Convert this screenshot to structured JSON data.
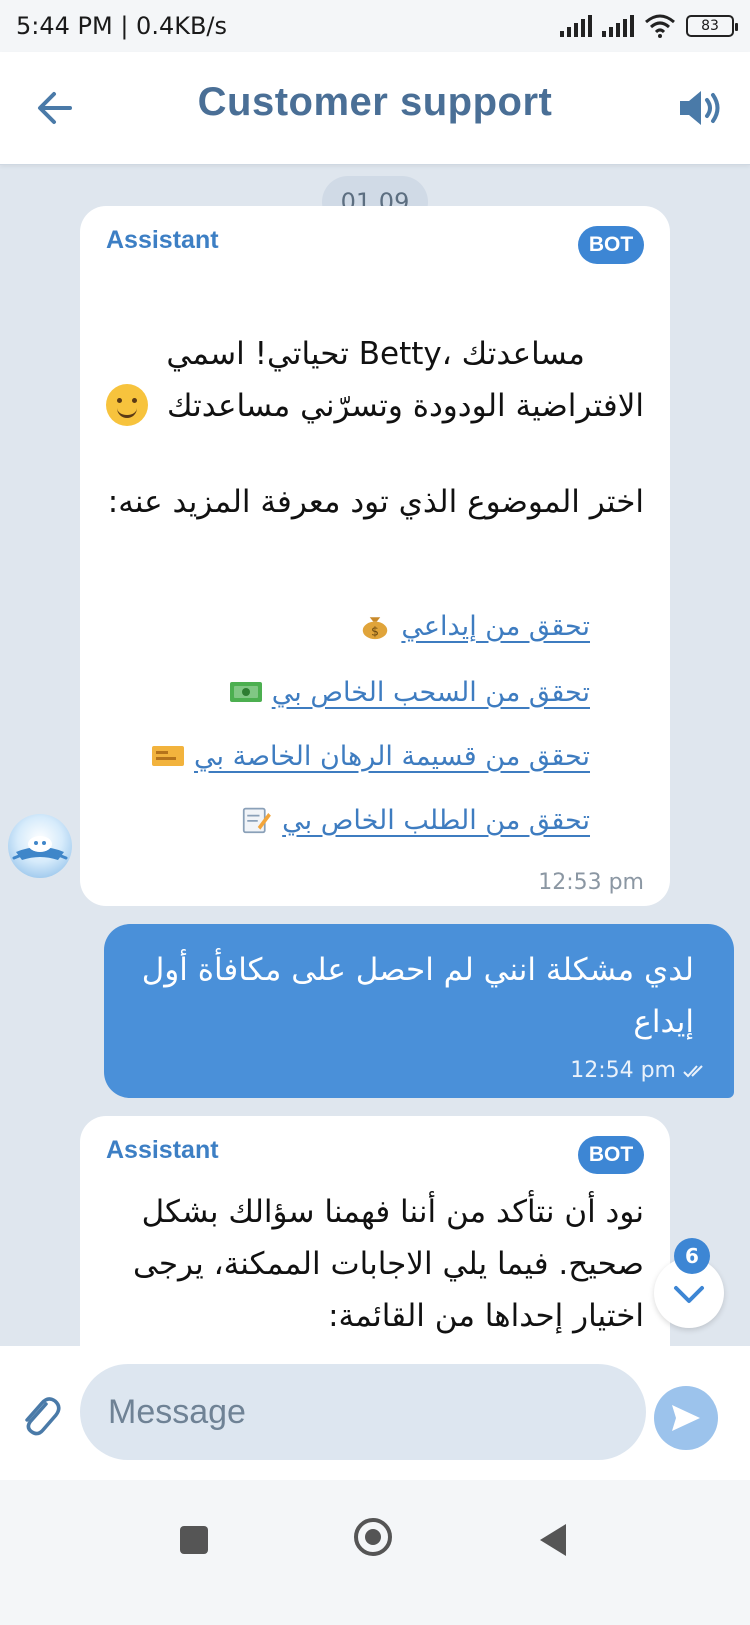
{
  "status_bar": {
    "time": "5:44 PM | 0.4KB/s",
    "battery": "83"
  },
  "header": {
    "title": "Customer support"
  },
  "chat": {
    "date_chip": "01.09",
    "message1": {
      "sender": "Assistant",
      "badge": "BOT",
      "text": "مساعدتك ،Betty تحياتي! اسمي الافتراضية الودودة وتسرّني مساعدتك",
      "prompt": "اختر الموضوع الذي تود معرفة المزيد عنه:",
      "links": [
        {
          "label": "تحقق من إيداعي",
          "icon": "money-bag-icon"
        },
        {
          "label": "تحقق من السحب الخاص بي",
          "icon": "banknote-icon"
        },
        {
          "label": "تحقق من قسيمة الرهان الخاصة بي",
          "icon": "ticket-icon"
        },
        {
          "label": "تحقق من الطلب الخاص بي",
          "icon": "memo-icon"
        }
      ],
      "time": "12:53 pm"
    },
    "message2": {
      "text": "لدي مشكلة انني لم احصل على مكافأة أول إيداع",
      "time": "12:54 pm"
    },
    "message3": {
      "sender": "Assistant",
      "badge": "BOT",
      "text": "نود أن نتأكد من أننا فهمنا سؤالك بشكل صحيح. فيما يلي الاجابات الممكنة، يرجى اختيار إحداها من القائمة:"
    },
    "unread_count": "6"
  },
  "composer": {
    "placeholder": "Message"
  }
}
